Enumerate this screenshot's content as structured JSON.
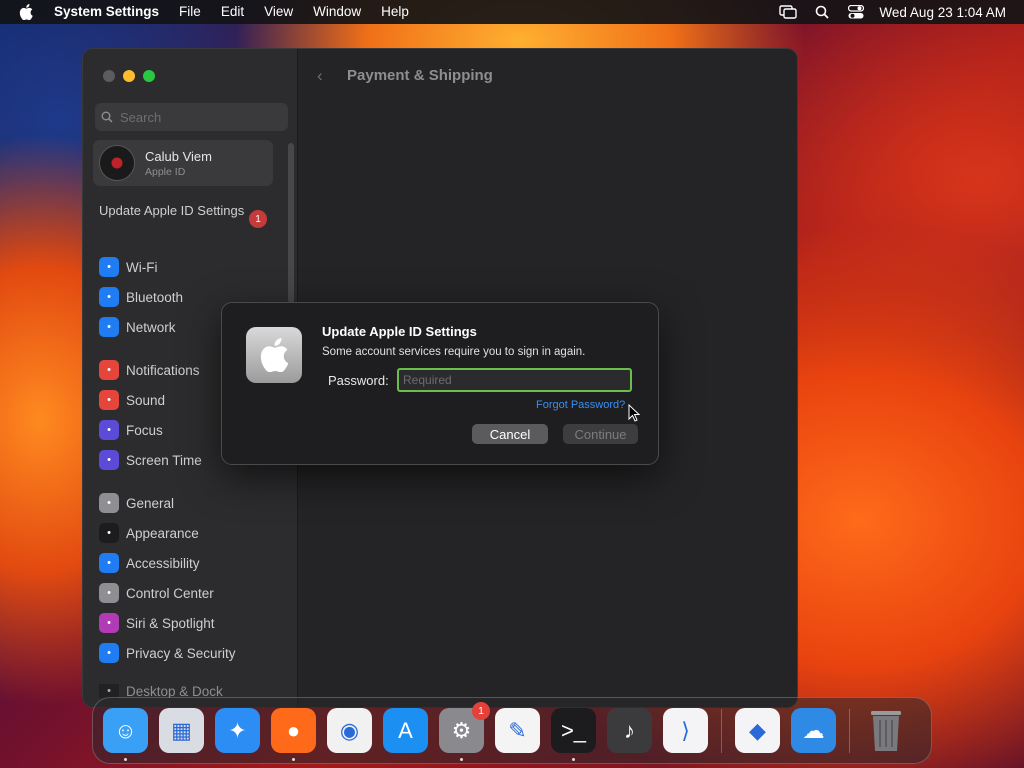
{
  "menubar": {
    "app_name": "System Settings",
    "items": [
      "File",
      "Edit",
      "View",
      "Window",
      "Help"
    ],
    "clock": "Wed Aug 23  1:04 AM"
  },
  "window": {
    "title": "Payment & Shipping",
    "search_placeholder": "Search",
    "profile": {
      "name": "Calub Viem",
      "subtitle": "Apple ID"
    },
    "update_notice": {
      "label": "Update Apple ID Settings",
      "badge": "1"
    },
    "sidebar": {
      "items": [
        {
          "label": "Wi-Fi",
          "icon": "wifi-icon",
          "color": "#1f7cf2"
        },
        {
          "label": "Bluetooth",
          "icon": "bluetooth-icon",
          "color": "#1f7cf2"
        },
        {
          "label": "Network",
          "icon": "network-icon",
          "color": "#1f7cf2"
        },
        {
          "label": "Notifications",
          "icon": "bell-icon",
          "color": "#e5453b"
        },
        {
          "label": "Sound",
          "icon": "speaker-icon",
          "color": "#e5453b"
        },
        {
          "label": "Focus",
          "icon": "moon-icon",
          "color": "#5c4bd8"
        },
        {
          "label": "Screen Time",
          "icon": "hourglass-icon",
          "color": "#5c4bd8"
        },
        {
          "label": "General",
          "icon": "gear-icon",
          "color": "#8e8e93"
        },
        {
          "label": "Appearance",
          "icon": "appearance-icon",
          "color": "#1c1c1e"
        },
        {
          "label": "Accessibility",
          "icon": "accessibility-icon",
          "color": "#1f7cf2"
        },
        {
          "label": "Control Center",
          "icon": "control-center-icon",
          "color": "#8e8e93"
        },
        {
          "label": "Siri & Spotlight",
          "icon": "siri-icon",
          "color": "#b03bb5"
        },
        {
          "label": "Privacy & Security",
          "icon": "hand-icon",
          "color": "#1f7cf2"
        },
        {
          "label": "Desktop & Dock",
          "icon": "desktop-icon",
          "color": "#1c1c1e"
        }
      ]
    }
  },
  "dialog": {
    "title": "Update Apple ID Settings",
    "message": "Some account services require you to sign in again.",
    "password_label": "Password:",
    "password_placeholder": "Required",
    "password_value": "",
    "forgot_link": "Forgot Password?",
    "cancel_label": "Cancel",
    "continue_label": "Continue"
  },
  "dock": {
    "apps": [
      {
        "name": "finder-icon",
        "color": "#3aa0f5",
        "glyph": "☺",
        "running": true
      },
      {
        "name": "launchpad-icon",
        "color": "#d9dce3",
        "glyph": "▦",
        "running": false
      },
      {
        "name": "safari-icon",
        "color": "#2c8ef5",
        "glyph": "✦",
        "running": false
      },
      {
        "name": "firefox-icon",
        "color": "#ff6a1a",
        "glyph": "●",
        "running": true
      },
      {
        "name": "chrome-icon",
        "color": "#f1f1f1",
        "glyph": "◉",
        "running": false
      },
      {
        "name": "app-store-icon",
        "color": "#1b8ff2",
        "glyph": "A",
        "running": false
      },
      {
        "name": "system-settings-icon",
        "color": "#8a8a8e",
        "glyph": "⚙",
        "running": true,
        "badge": "1"
      },
      {
        "name": "textedit-icon",
        "color": "#f4f4f4",
        "glyph": "✎",
        "running": false
      },
      {
        "name": "terminal-icon",
        "color": "#1c1c1e",
        "glyph": ">_",
        "running": true
      },
      {
        "name": "garageband-icon",
        "color": "#3b3b3d",
        "glyph": "♪",
        "running": false
      },
      {
        "name": "vscode-icon",
        "color": "#f4f4f6",
        "glyph": "⟩",
        "running": false
      }
    ],
    "apps_after_separator": [
      {
        "name": "visual-studio-icon",
        "color": "#f4f4f6",
        "glyph": "◆",
        "running": false
      },
      {
        "name": "weather-icon",
        "color": "#2f8ae6",
        "glyph": "☁",
        "running": false
      }
    ],
    "trash": {
      "name": "trash-icon",
      "color": "#6f6f72",
      "glyph": "🗑"
    }
  }
}
